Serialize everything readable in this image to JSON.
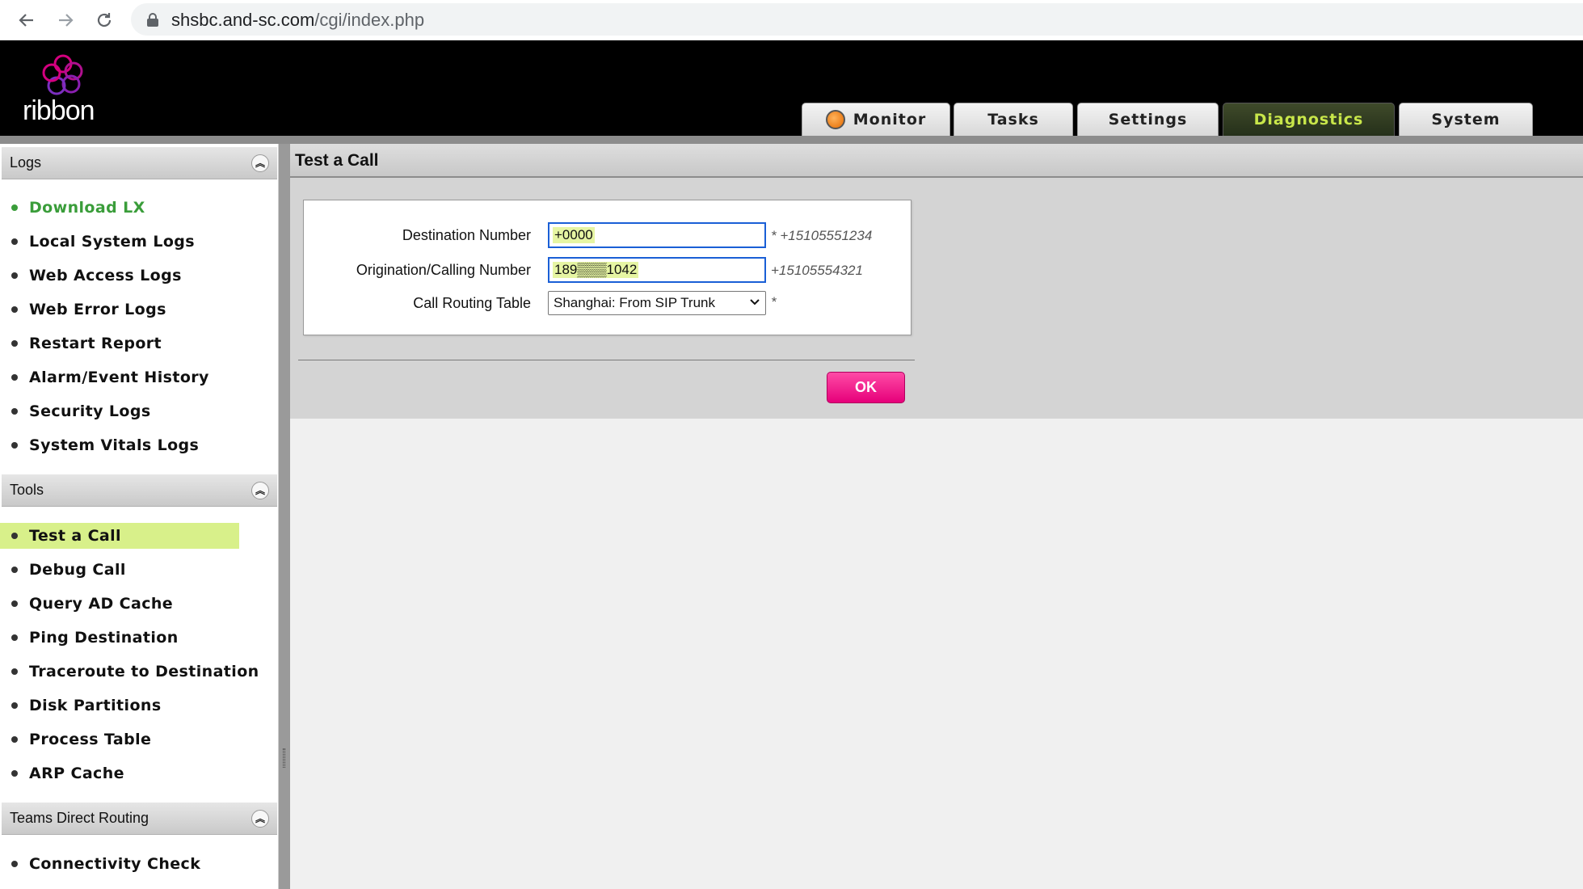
{
  "browser": {
    "url_host": "shsbc.and-sc.com",
    "url_path": "/cgi/index.php",
    "back_icon": "back-arrow-icon",
    "forward_icon": "forward-arrow-icon",
    "reload_icon": "reload-icon"
  },
  "brand": {
    "logo_text": "ribbon",
    "colors": {
      "logo_ring": "#d4007f",
      "logo_accent": "#7b2fbf"
    }
  },
  "tabs": [
    {
      "label": "Monitor",
      "active": false
    },
    {
      "label": "Tasks",
      "active": false
    },
    {
      "label": "Settings",
      "active": false
    },
    {
      "label": "Diagnostics",
      "active": true
    },
    {
      "label": "System",
      "active": false
    }
  ],
  "sidebar": {
    "sections": [
      {
        "title": "Logs",
        "items": [
          {
            "label": "Download LX",
            "highlight": "green"
          },
          {
            "label": "Local System Logs"
          },
          {
            "label": "Web Access Logs"
          },
          {
            "label": "Web Error Logs"
          },
          {
            "label": "Restart Report"
          },
          {
            "label": "Alarm/Event History"
          },
          {
            "label": "Security Logs"
          },
          {
            "label": "System Vitals Logs"
          }
        ]
      },
      {
        "title": "Tools",
        "items": [
          {
            "label": "Test a Call",
            "selected": true
          },
          {
            "label": "Debug Call"
          },
          {
            "label": "Query AD Cache"
          },
          {
            "label": "Ping Destination"
          },
          {
            "label": "Traceroute to Destination"
          },
          {
            "label": "Disk Partitions"
          },
          {
            "label": "Process Table"
          },
          {
            "label": "ARP Cache"
          }
        ]
      },
      {
        "title": "Teams Direct Routing",
        "items": [
          {
            "label": "Connectivity Check"
          }
        ]
      }
    ]
  },
  "main": {
    "title": "Test a Call",
    "form": {
      "destination": {
        "label": "Destination Number",
        "value": "+0000",
        "hint": "* +15105551234"
      },
      "origination": {
        "label": "Origination/Calling Number",
        "value": "189▒▒▒1042",
        "hint": "+15105554321"
      },
      "routing": {
        "label": "Call Routing Table",
        "value": "Shanghai: From SIP Trunk",
        "hint": "*"
      }
    },
    "ok_label": "OK"
  }
}
